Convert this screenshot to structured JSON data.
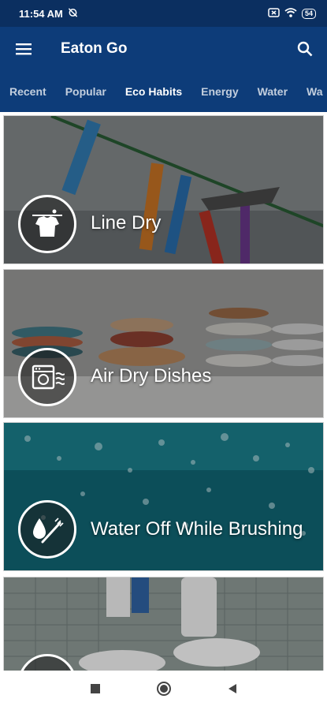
{
  "status_bar": {
    "time": "11:54 AM",
    "battery": "54",
    "icons": [
      "alarm-off-icon",
      "screen-icon",
      "wifi-icon",
      "battery-icon"
    ]
  },
  "app_bar": {
    "title": "Eaton Go",
    "icons": [
      "menu-icon",
      "search-icon"
    ]
  },
  "tabs": [
    {
      "label": "Recent",
      "active": false
    },
    {
      "label": "Popular",
      "active": false
    },
    {
      "label": "Eco Habits",
      "active": true
    },
    {
      "label": "Energy",
      "active": false
    },
    {
      "label": "Water",
      "active": false
    },
    {
      "label": "Wa",
      "active": false
    }
  ],
  "cards": [
    {
      "label": "Line Dry",
      "icon": "shirt-drying-icon"
    },
    {
      "label": "Air Dry Dishes",
      "icon": "dishwasher-icon"
    },
    {
      "label": "Water Off While Brushing",
      "icon": "toothbrush-water-icon"
    },
    {
      "label": "",
      "icon": "toilet-icon"
    }
  ],
  "nav_bar": {
    "icons": [
      "recents-square-icon",
      "home-circle-icon",
      "back-triangle-icon"
    ]
  },
  "colors": {
    "status_bar": "#0b2f60",
    "app_bar": "#0d3c79",
    "text_on_primary": "#ffffff"
  }
}
